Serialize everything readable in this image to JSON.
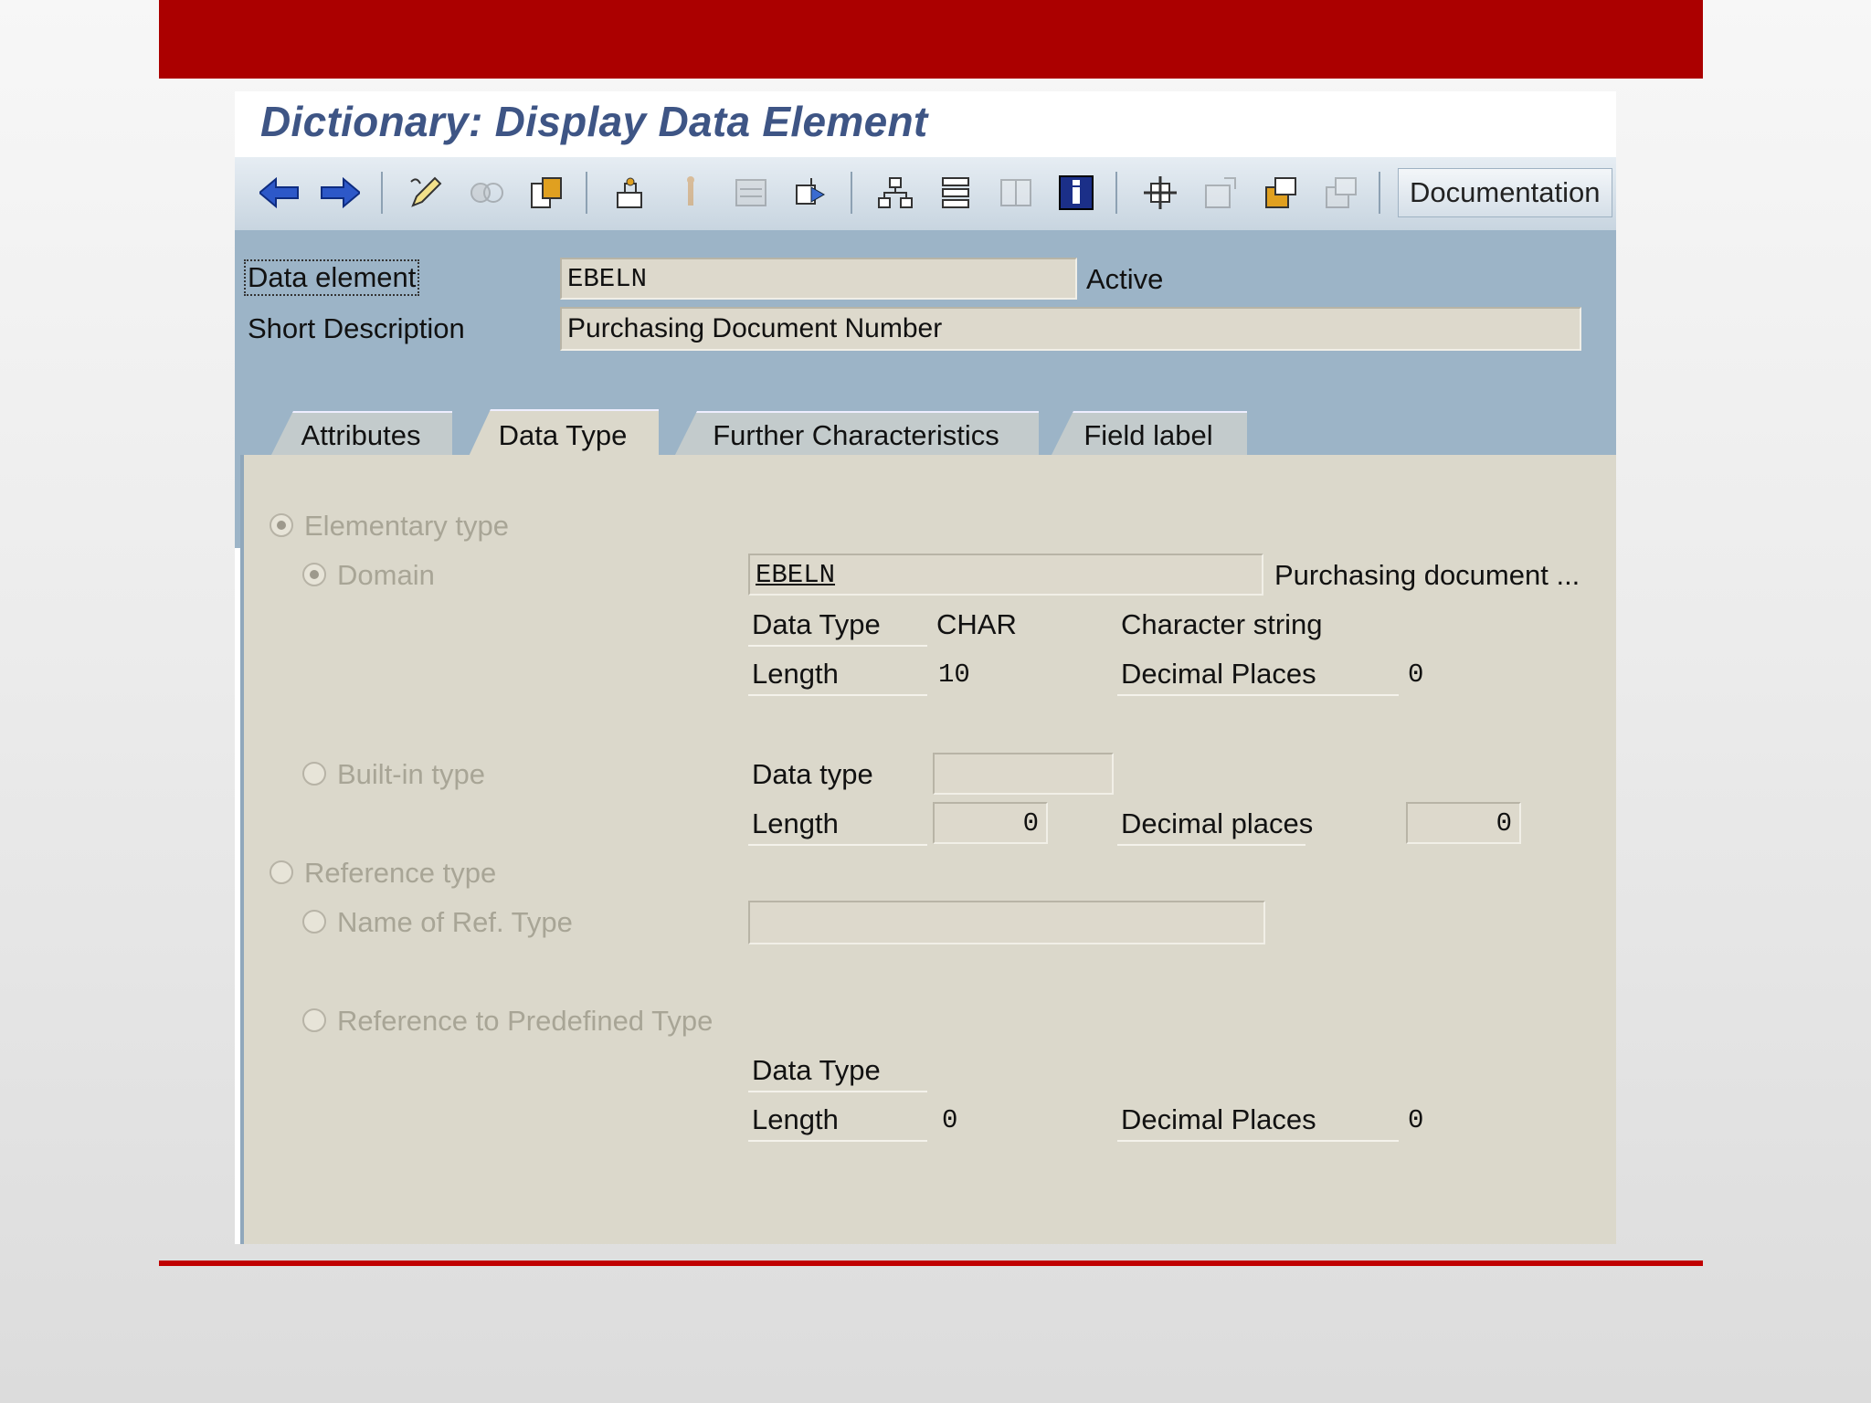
{
  "window": {
    "title": "Dictionary: Display Data Element"
  },
  "toolbar": {
    "icons": [
      "back-arrow-icon",
      "forward-arrow-icon",
      "edit-pencil-icon",
      "display-change-icon",
      "object-list-icon",
      "where-used-icon",
      "activate-icon",
      "other-object-icon",
      "navigate-icon",
      "hierarchy-icon",
      "stack-icon",
      "frame-icon",
      "info-icon",
      "move-icon",
      "check-icon",
      "copy-icon",
      "paste-icon"
    ],
    "documentation_label": "Documentation"
  },
  "header": {
    "data_element_label": "Data element",
    "data_element_value": "EBELN",
    "status": "Active",
    "short_description_label": "Short Description",
    "short_description_value": "Purchasing Document Number"
  },
  "tabs": [
    {
      "label": "Attributes",
      "active": false
    },
    {
      "label": "Data Type",
      "active": true
    },
    {
      "label": "Further Characteristics",
      "active": false
    },
    {
      "label": "Field label",
      "active": false
    }
  ],
  "data_type_tab": {
    "elementary_type_label": "Elementary type",
    "domain_label": "Domain",
    "domain_value": "EBELN",
    "domain_description": "Purchasing document ...",
    "domain_data_type_label": "Data Type",
    "domain_data_type_value": "CHAR",
    "domain_data_type_text": "Character string",
    "domain_length_label": "Length",
    "domain_length_value": "10",
    "domain_decimal_label": "Decimal Places",
    "domain_decimal_value": "0",
    "builtin_label": "Built-in type",
    "builtin_data_type_label": "Data type",
    "builtin_data_type_value": "",
    "builtin_length_label": "Length",
    "builtin_length_value": "0",
    "builtin_decimal_label": "Decimal places",
    "builtin_decimal_value": "0",
    "reference_type_label": "Reference type",
    "ref_name_label": "Name of Ref. Type",
    "ref_name_value": "",
    "ref_predefined_label": "Reference to Predefined Type",
    "ref_data_type_label": "Data Type",
    "ref_length_label": "Length",
    "ref_length_value": "0",
    "ref_decimal_label": "Decimal Places",
    "ref_decimal_value": "0"
  },
  "colors": {
    "slide_accent": "#ab0000",
    "title_blue": "#3e5585",
    "header_bg": "#9cb4c7",
    "panel_bg": "#dbd8cb"
  }
}
